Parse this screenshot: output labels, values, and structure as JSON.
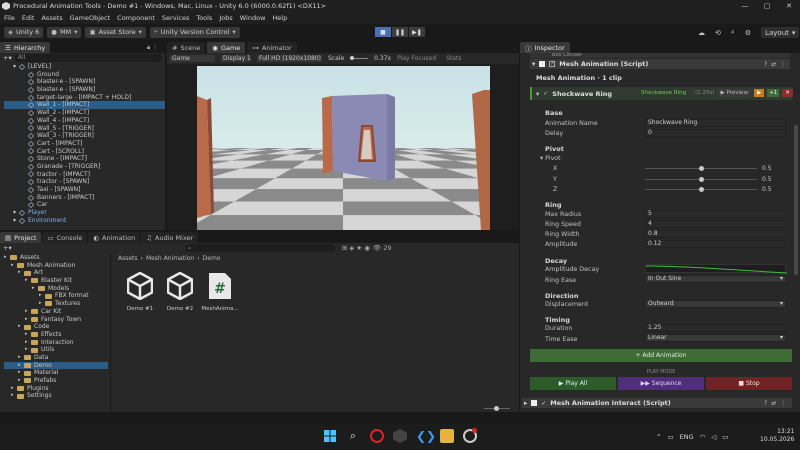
{
  "window": {
    "title": "Procedural Animation Tools - Demo #1 - Windows, Mac, Linux - Unity 6.0 (6000.0.62f1) <DX11>",
    "controls": [
      "—",
      "▢",
      "✕"
    ]
  },
  "menu": [
    "File",
    "Edit",
    "Assets",
    "GameObject",
    "Component",
    "Services",
    "Tools",
    "Jobs",
    "Window",
    "Help"
  ],
  "toolbar": {
    "unity_label": "Unity 6",
    "account_label": "MM",
    "asset_store_label": "Asset Store",
    "version_control_label": "Unity Version Control",
    "layout_label": "Layout"
  },
  "hierarchy": {
    "tab": "Hierarchy",
    "search_placeholder": "All",
    "items": [
      {
        "label": "[LEVEL]",
        "indent": 1,
        "type": "root"
      },
      {
        "label": "Ground",
        "indent": 2,
        "type": "obj"
      },
      {
        "label": "blaster-e - [SPAWN]",
        "indent": 2,
        "type": "obj"
      },
      {
        "label": "blaster-e - [SPAWN]",
        "indent": 2,
        "type": "obj"
      },
      {
        "label": "target-large - [IMPACT + HOLD]",
        "indent": 2,
        "type": "obj"
      },
      {
        "label": "Wall_1 - [IMPACT]",
        "indent": 2,
        "type": "sel"
      },
      {
        "label": "Wall_2 - [IMPACT]",
        "indent": 2,
        "type": "obj"
      },
      {
        "label": "Wall_4 - [IMPACT]",
        "indent": 2,
        "type": "obj"
      },
      {
        "label": "Wall_5 - [TRIGGER]",
        "indent": 2,
        "type": "obj"
      },
      {
        "label": "Wall_3 - [TRIGGER]",
        "indent": 2,
        "type": "obj"
      },
      {
        "label": "Cart - [IMPACT]",
        "indent": 2,
        "type": "obj"
      },
      {
        "label": "Cart - [SCROLL]",
        "indent": 2,
        "type": "obj"
      },
      {
        "label": "Stone - [IMPACT]",
        "indent": 2,
        "type": "obj"
      },
      {
        "label": "Granade - [TRIGGER]",
        "indent": 2,
        "type": "obj"
      },
      {
        "label": "tractor - [IMPACT]",
        "indent": 2,
        "type": "obj"
      },
      {
        "label": "tractor - [SPAWN]",
        "indent": 2,
        "type": "obj"
      },
      {
        "label": "Taxi - [SPAWN]",
        "indent": 2,
        "type": "obj"
      },
      {
        "label": "Banners - [IMPACT]",
        "indent": 2,
        "type": "obj"
      },
      {
        "label": "Car",
        "indent": 2,
        "type": "obj"
      },
      {
        "label": "Player",
        "indent": 1,
        "type": "blue"
      },
      {
        "label": "Environment",
        "indent": 1,
        "type": "blue"
      }
    ]
  },
  "scene_tabs": [
    {
      "label": "Scene",
      "active": false
    },
    {
      "label": "Game",
      "active": true
    },
    {
      "label": "Animator",
      "active": false
    }
  ],
  "game_bar": {
    "mode": "Game",
    "display": "Display 1",
    "resolution": "Full HD (1920x1080)",
    "scale_label": "Scale",
    "scale_value": "0.37x",
    "play_focused": "Play Focused",
    "stats": "Stats"
  },
  "bottom_tabs": [
    {
      "label": "Project",
      "active": true
    },
    {
      "label": "Console",
      "active": false
    },
    {
      "label": "Animation",
      "active": false
    },
    {
      "label": "Audio Mixer",
      "active": false
    }
  ],
  "project": {
    "breadcrumb": [
      "Assets",
      "Mesh Animation",
      "Demo"
    ],
    "asset_count": "29",
    "tree": [
      {
        "label": "Assets",
        "indent": 0
      },
      {
        "label": "Mesh Animation",
        "indent": 1
      },
      {
        "label": "Art",
        "indent": 2
      },
      {
        "label": "Blaster Kit",
        "indent": 3
      },
      {
        "label": "Models",
        "indent": 4
      },
      {
        "label": "FBX format",
        "indent": 5
      },
      {
        "label": "Textures",
        "indent": 5
      },
      {
        "label": "Car Kit",
        "indent": 3
      },
      {
        "label": "Fantasy Town",
        "indent": 3
      },
      {
        "label": "Code",
        "indent": 2
      },
      {
        "label": "Effects",
        "indent": 3
      },
      {
        "label": "Interaction",
        "indent": 3
      },
      {
        "label": "Utils",
        "indent": 3
      },
      {
        "label": "Data",
        "indent": 2
      },
      {
        "label": "Demo",
        "indent": 2,
        "selected": true
      },
      {
        "label": "Material",
        "indent": 2
      },
      {
        "label": "Prefabs",
        "indent": 2
      },
      {
        "label": "Plugins",
        "indent": 1
      },
      {
        "label": "Settings",
        "indent": 1
      }
    ],
    "assets": [
      {
        "label": "Demo #1",
        "kind": "unity"
      },
      {
        "label": "Demo #2",
        "kind": "unity"
      },
      {
        "label": "MeshAnima...",
        "kind": "script"
      }
    ],
    "zoom": 0.45
  },
  "inspector": {
    "tab": "Inspector",
    "partial_header": "Box Collider",
    "component_title": "Mesh Animation (Script)",
    "clips_label": "Mesh Animation · 1 clip",
    "clip": {
      "name": "Shockwave Ring",
      "tag": "Shockwave Ring",
      "duration": "(1.25s)",
      "preview": "Preview",
      "plus": "+1"
    },
    "sections": {
      "base": "Base",
      "pivot": "Pivot",
      "ring": "Ring",
      "decay": "Decay",
      "direction": "Direction",
      "timing": "Timing"
    },
    "fields": {
      "animation_name_label": "Animation Name",
      "animation_name": "Shockwave Ring",
      "delay_label": "Delay",
      "delay": "0",
      "pivot_label": "Pivot",
      "x_label": "X",
      "x": "0.5",
      "y_label": "Y",
      "y": "0.5",
      "z_label": "Z",
      "z": "0.5",
      "max_radius_label": "Max Radius",
      "max_radius": "5",
      "ring_speed_label": "Ring Speed",
      "ring_speed": "4",
      "ring_width_label": "Ring Width",
      "ring_width": "0.8",
      "amplitude_label": "Amplitude",
      "amplitude": "0.12",
      "amplitude_decay_label": "Amplitude Decay",
      "ring_ease_label": "Ring Ease",
      "ring_ease": "In Out Sine",
      "displacement_label": "Displacement",
      "displacement": "Outward",
      "duration_label": "Duration",
      "duration": "1.25",
      "time_ease_label": "Time Ease",
      "time_ease": "Linear"
    },
    "pivot_fraction": 0.5,
    "add_animation": "+ Add Animation",
    "play_mode": "PLAY MODE",
    "play_all": "Play All",
    "sequence": "Sequence",
    "stop": "Stop",
    "next_component": "Mesh Animation Interact (Script)"
  },
  "taskbar": {
    "language": "ENG",
    "time": "13:21",
    "date": "10.05.2026"
  },
  "colors": {
    "accent_green": "#4a9a3a",
    "clip_tag": "#6ecf5a",
    "selection": "#2c5d87",
    "sequence_purple": "#6e3f9e",
    "stop_red": "#9e2f2f"
  }
}
